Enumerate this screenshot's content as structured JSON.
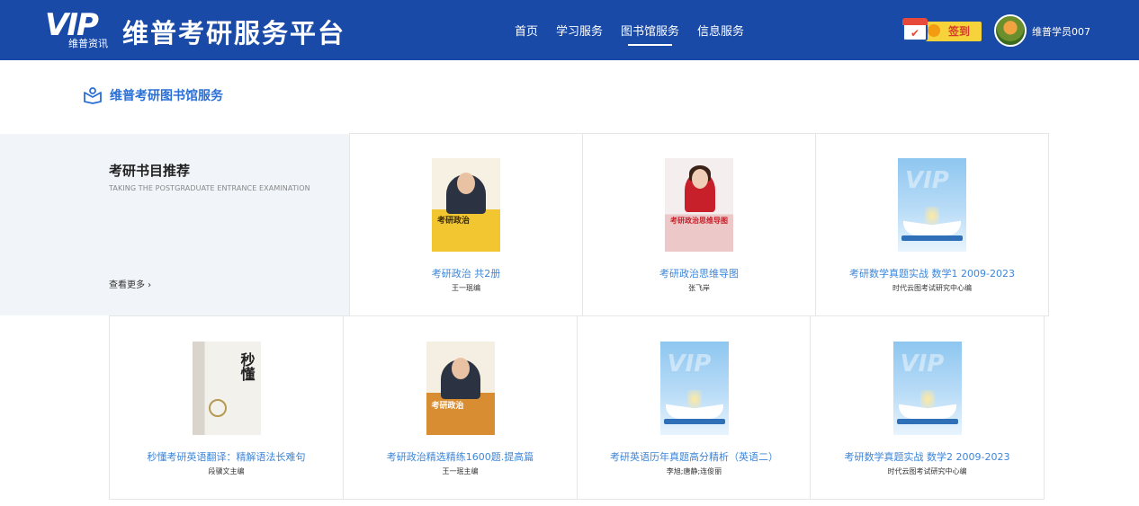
{
  "header": {
    "logo_text": "VIP",
    "logo_sub": "维普资讯",
    "site_title": "维普考研服务平台",
    "nav": [
      {
        "label": "首页",
        "active": false
      },
      {
        "label": "学习服务",
        "active": false
      },
      {
        "label": "图书馆服务",
        "active": true
      },
      {
        "label": "信息服务",
        "active": false
      }
    ],
    "checkin_label": "签到",
    "username": "维普学员007"
  },
  "section": {
    "title": "维普考研图书馆服务"
  },
  "promo": {
    "title": "考研书目推荐",
    "subtitle": "TAKING THE POSTGRADUATE ENTRANCE EXAMINATION",
    "more": "查看更多 ›"
  },
  "books": [
    {
      "title": "考研政治 共2册",
      "author": "王一珉编",
      "cover": "politics1",
      "cover_text": "考研政治"
    },
    {
      "title": "考研政治思维导图",
      "author": "张飞岸",
      "cover": "mindmap",
      "cover_text": "考研政治思维导图"
    },
    {
      "title": "考研数学真题实战 数学1 2009-2023",
      "author": "时代云图考试研究中心编",
      "cover": "generic"
    },
    {
      "title": "秒懂考研英语翻译：精解语法长难句",
      "author": "段骥文主编",
      "cover": "english",
      "cover_text": "秒懂"
    },
    {
      "title": "考研政治精选精练1600题.提高篇",
      "author": "王一珉主编",
      "cover": "politics2",
      "cover_text": "考研政治"
    },
    {
      "title": "考研英语历年真题高分精析（英语二）",
      "author": "李旭;唐静;连俊丽",
      "cover": "generic"
    },
    {
      "title": "考研数学真题实战 数学2 2009-2023",
      "author": "时代云图考试研究中心编",
      "cover": "generic"
    }
  ],
  "colors": {
    "header_bg": "#1a4aa8",
    "accent": "#2a6fd6",
    "link": "#3d86d9",
    "checkin_bg": "#f6d33a"
  }
}
